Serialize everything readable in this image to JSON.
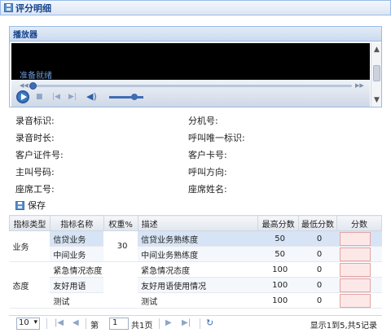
{
  "window": {
    "title": "评分明细"
  },
  "player": {
    "title": "播放器",
    "status": "准备就绪"
  },
  "info": {
    "left": [
      {
        "label": "录音标识:"
      },
      {
        "label": "录音时长:"
      },
      {
        "label": "客户证件号:"
      },
      {
        "label": "主叫号码:"
      },
      {
        "label": "座席工号:"
      }
    ],
    "right": [
      {
        "label": "分机号:"
      },
      {
        "label": "呼叫唯一标识:"
      },
      {
        "label": "客户卡号:"
      },
      {
        "label": "呼叫方向:"
      },
      {
        "label": "座席姓名:"
      }
    ]
  },
  "toolbar": {
    "save_label": "保存"
  },
  "table": {
    "headers": [
      "指标类型",
      "指标名称",
      "权重%",
      "描述",
      "最高分数",
      "最低分数",
      "分数"
    ],
    "groups": [
      {
        "type": "业务",
        "weight": "30"
      },
      {
        "type": "态度",
        "weight": ""
      }
    ],
    "rows": [
      {
        "name": "信贷业务",
        "desc": "信贷业务熟练度",
        "max": "50",
        "min": "0"
      },
      {
        "name": "中间业务",
        "desc": "中间业务熟练度",
        "max": "50",
        "min": "0"
      },
      {
        "name": "紧急情况态度",
        "desc": "紧急情况态度",
        "max": "100",
        "min": "0"
      },
      {
        "name": "友好用语",
        "desc": "友好用语使用情况",
        "max": "100",
        "min": "0"
      },
      {
        "name": "测试",
        "desc": "测试",
        "max": "100",
        "min": "0"
      }
    ]
  },
  "pager": {
    "page_size": "10",
    "page_prefix": "第",
    "page_current": "1",
    "page_suffix": "共1页",
    "summary": "显示1到5,共5记录"
  }
}
